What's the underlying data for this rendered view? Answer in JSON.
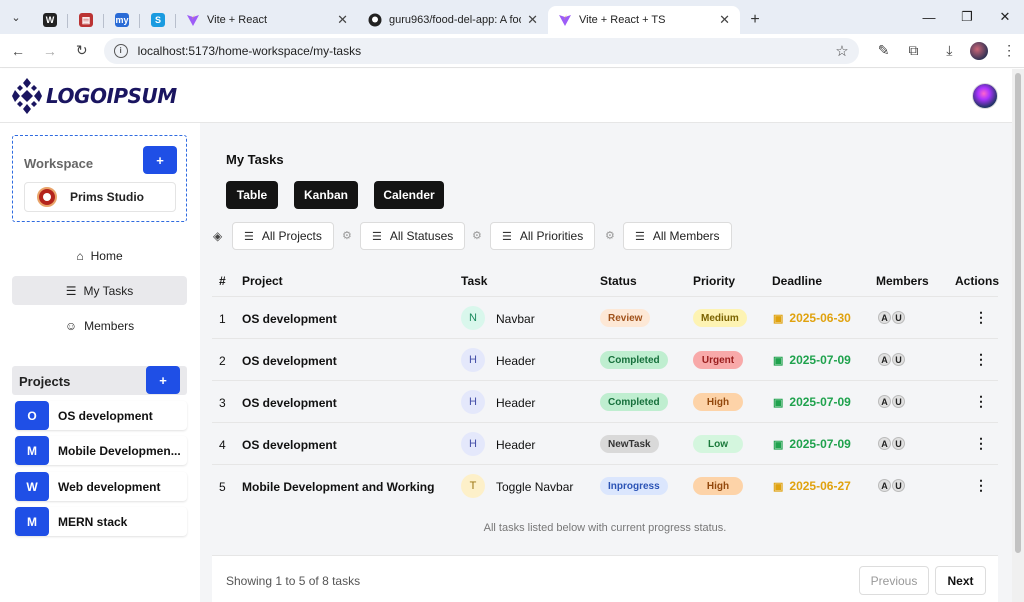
{
  "browser": {
    "tabs": [
      {
        "title": "Vite + React",
        "active": false
      },
      {
        "title": "guru963/food-del-app: A food",
        "active": false
      },
      {
        "title": "Vite + React + TS",
        "active": true
      }
    ],
    "mini_tabs": [
      {
        "icon": "w-icon",
        "glyph": "W",
        "color": "#222"
      },
      {
        "icon": "document-icon",
        "glyph": "▤",
        "color": "#b33"
      },
      {
        "icon": "my-icon",
        "glyph": "my",
        "color": "#2a6bd6"
      },
      {
        "icon": "s-icon",
        "glyph": "S",
        "color": "#1a9be0"
      }
    ],
    "url": "localhost:5173/home-workspace/my-tasks"
  },
  "header": {
    "logo_text": "LOGOIPSUM"
  },
  "sidebar": {
    "workspace_label": "Workspace",
    "add_label": "+",
    "workspace_name": "Prims Studio",
    "nav": [
      {
        "label": "Home",
        "icon": "home-icon",
        "glyph": "⌂",
        "active": false
      },
      {
        "label": "My Tasks",
        "icon": "list-icon",
        "glyph": "☰",
        "active": true
      },
      {
        "label": "Members",
        "icon": "user-icon",
        "glyph": "☺",
        "active": false
      }
    ],
    "projects_label": "Projects",
    "projects": [
      {
        "badge": "O",
        "name": "OS development"
      },
      {
        "badge": "M",
        "name": "Mobile Developmen..."
      },
      {
        "badge": "W",
        "name": "Web development"
      },
      {
        "badge": "M",
        "name": "MERN stack"
      }
    ]
  },
  "main": {
    "title": "My Tasks",
    "views": [
      "Table",
      "Kanban",
      "Calender"
    ],
    "filters": [
      "All Projects",
      "All Statuses",
      "All Priorities",
      "All Members"
    ],
    "columns": [
      "#",
      "Project",
      "Task",
      "Status",
      "Priority",
      "Deadline",
      "Members",
      "Actions"
    ],
    "rows": [
      {
        "num": "1",
        "project": "OS development",
        "initial": "N",
        "initial_bg": "#d9f7ec",
        "initial_fg": "#1a8a5e",
        "task": "Navbar",
        "status": "Review",
        "status_bg": "#fde8d6",
        "status_fg": "#a0521b",
        "priority": "Medium",
        "priority_bg": "#fdf3b3",
        "priority_fg": "#7a6200",
        "deadline": "2025-06-30",
        "deadline_color": "#e0a20e",
        "members": [
          "A",
          "U"
        ]
      },
      {
        "num": "2",
        "project": "OS development",
        "initial": "H",
        "initial_bg": "#e4e8fb",
        "initial_fg": "#4650a8",
        "task": "Header",
        "status": "Completed",
        "status_bg": "#bfeed0",
        "status_fg": "#17703c",
        "priority": "Urgent",
        "priority_bg": "#f8a9a9",
        "priority_fg": "#9a1d1d",
        "deadline": "2025-07-09",
        "deadline_color": "#1fa24d",
        "members": [
          "A",
          "U"
        ]
      },
      {
        "num": "3",
        "project": "OS development",
        "initial": "H",
        "initial_bg": "#e4e8fb",
        "initial_fg": "#4650a8",
        "task": "Header",
        "status": "Completed",
        "status_bg": "#bfeed0",
        "status_fg": "#17703c",
        "priority": "High",
        "priority_bg": "#fdd3a8",
        "priority_fg": "#93480c",
        "deadline": "2025-07-09",
        "deadline_color": "#1fa24d",
        "members": [
          "A",
          "U"
        ]
      },
      {
        "num": "4",
        "project": "OS development",
        "initial": "H",
        "initial_bg": "#e4e8fb",
        "initial_fg": "#4650a8",
        "task": "Header",
        "status": "NewTask",
        "status_bg": "#d9d9d9",
        "status_fg": "#333333",
        "priority": "Low",
        "priority_bg": "#d4f6de",
        "priority_fg": "#1c7a3c",
        "deadline": "2025-07-09",
        "deadline_color": "#1fa24d",
        "members": [
          "A",
          "U"
        ]
      },
      {
        "num": "5",
        "project": "Mobile Development and Working",
        "initial": "T",
        "initial_bg": "#fdf0c9",
        "initial_fg": "#9a7410",
        "task": "Toggle Navbar",
        "status": "Inprogress",
        "status_bg": "#dbe6fd",
        "status_fg": "#2b53b5",
        "priority": "High",
        "priority_bg": "#fdd3a8",
        "priority_fg": "#93480c",
        "deadline": "2025-06-27",
        "deadline_color": "#e0a20e",
        "members": [
          "A",
          "U"
        ]
      }
    ],
    "caption": "All tasks listed below with current progress status.",
    "footer_info": "Showing 1 to 5 of 8 tasks",
    "previous": "Previous",
    "next": "Next"
  },
  "colors": {
    "accent": "#1f4fe6",
    "dark_button": "#141414"
  }
}
